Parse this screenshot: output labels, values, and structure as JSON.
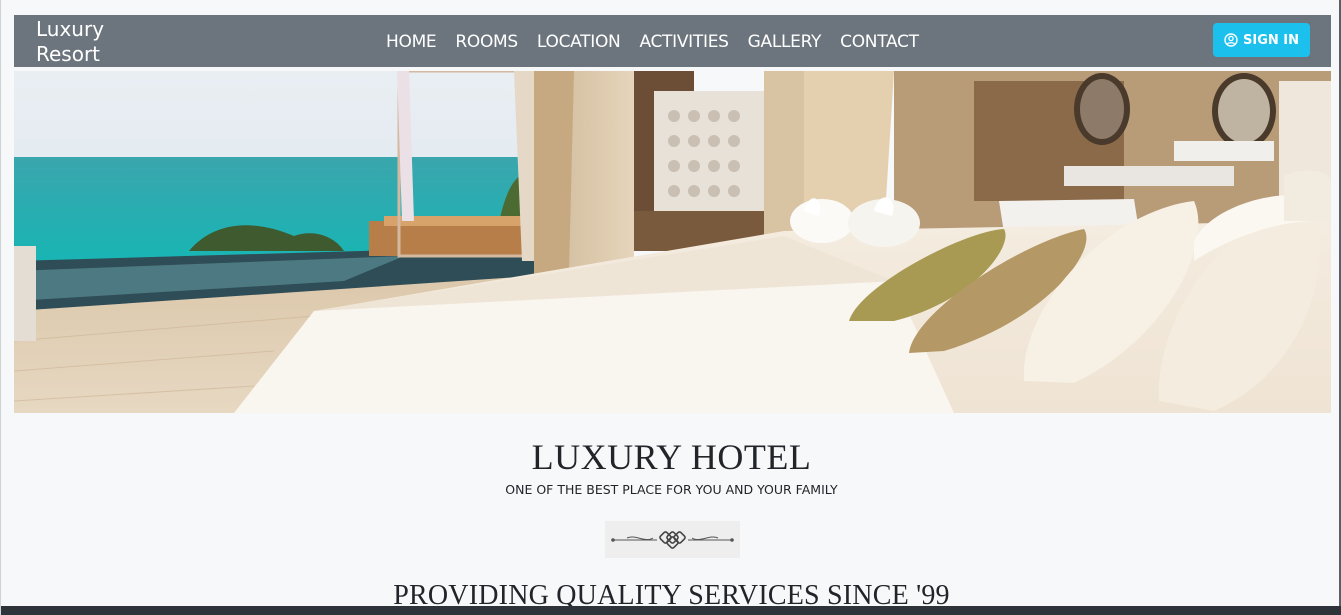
{
  "navbar": {
    "brand_line1": "Luxury",
    "brand_line2": "Resort",
    "links": [
      "HOME",
      "ROOMS",
      "LOCATION",
      "ACTIVITIES",
      "GALLERY",
      "CONTACT"
    ],
    "signin_label": "SIGN IN",
    "signin_icon": "user-circle-icon",
    "bg_color": "#6c757d",
    "signin_color": "#1cc0ec"
  },
  "hero": {
    "image_description_icon": "hotel-room-photo"
  },
  "intro": {
    "title": "LUXURY HOTEL",
    "subtitle": "ONE OF THE BEST PLACE FOR YOU AND YOUR FAMILY",
    "divider_icon": "ornamental-divider-icon"
  },
  "section": {
    "tagline": "PROVIDING QUALITY SERVICES SINCE '99"
  }
}
